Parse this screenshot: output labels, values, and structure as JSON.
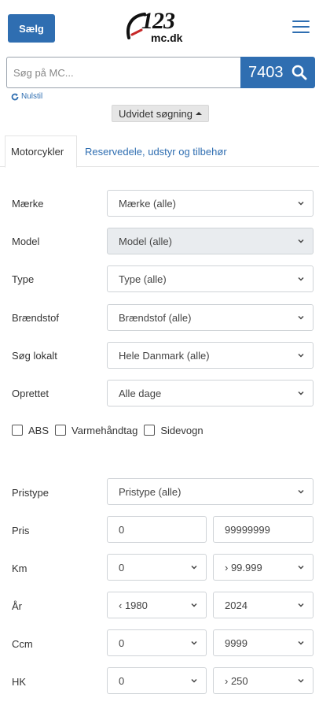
{
  "header": {
    "sell_label": "Sælg",
    "logo_number": "123",
    "logo_domain": "mc.dk",
    "menu_icon": "hamburger-menu-icon"
  },
  "search": {
    "placeholder": "Søg på MC...",
    "count": "7403",
    "reset_label": "Nulstil",
    "advanced_label": "Udvidet søgning"
  },
  "tabs": [
    {
      "label": "Motorcykler",
      "active": true
    },
    {
      "label": "Reservedele, udstyr og tilbehør",
      "active": false
    }
  ],
  "filters": {
    "make": {
      "label": "Mærke",
      "value": "Mærke (alle)"
    },
    "model": {
      "label": "Model",
      "value": "Model (alle)"
    },
    "type": {
      "label": "Type",
      "value": "Type (alle)"
    },
    "fuel": {
      "label": "Brændstof",
      "value": "Brændstof (alle)"
    },
    "local": {
      "label": "Søg lokalt",
      "value": "Hele Danmark (alle)"
    },
    "created": {
      "label": "Oprettet",
      "value": "Alle dage"
    },
    "checkboxes": [
      "ABS",
      "Varmehåndtag",
      "Sidevogn"
    ],
    "price_type": {
      "label": "Pristype",
      "value": "Pristype (alle)"
    },
    "price": {
      "label": "Pris",
      "from": "0",
      "to": "99999999"
    },
    "km": {
      "label": "Km",
      "from": "0",
      "to": "› 99.999"
    },
    "year": {
      "label": "År",
      "from": "‹ 1980",
      "to": "2024"
    },
    "ccm": {
      "label": "Ccm",
      "from": "0",
      "to": "9999"
    },
    "hp": {
      "label": "HK",
      "from": "0",
      "to": "› 250"
    }
  },
  "colors": {
    "brand": "#2f6eb1",
    "disabled_bg": "#e9ecef"
  }
}
